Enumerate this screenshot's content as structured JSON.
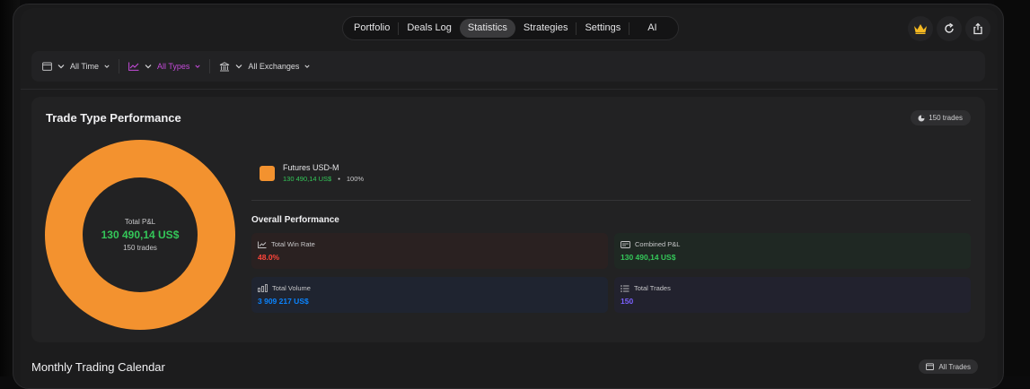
{
  "nav": {
    "tabs": [
      {
        "label": "Portfolio"
      },
      {
        "label": "Deals Log"
      },
      {
        "label": "Statistics"
      },
      {
        "label": "Strategies"
      },
      {
        "label": "Settings"
      },
      {
        "label": "AI"
      }
    ],
    "active": "Statistics",
    "icons": [
      "crown-icon",
      "refresh-icon",
      "share-icon"
    ]
  },
  "filters": {
    "time": "All Time",
    "types": "All Types",
    "exchanges": "All Exchanges"
  },
  "colors": {
    "accent_orange": "#f3922f",
    "positive_green": "#34c759",
    "negative_red": "#ff453a",
    "info_blue": "#0a84ff",
    "purple": "#7b61ff",
    "types_magenta": "#c44bd9"
  },
  "trade_type": {
    "title": "Trade Type Performance",
    "trades_badge": "150 trades",
    "total_label": "Total P&L",
    "total_value": "130 490,14 US$",
    "total_trades": "150 trades",
    "legend": [
      {
        "name": "Futures USD-M",
        "value": "130 490,14 US$",
        "percent": "100%"
      }
    ],
    "overall_title": "Overall Performance",
    "stats": {
      "win_rate": {
        "label": "Total Win Rate",
        "value": "48.0%"
      },
      "combined_pnl": {
        "label": "Combined P&L",
        "value": "130 490,14 US$"
      },
      "volume": {
        "label": "Total Volume",
        "value": "3 909 217 US$"
      },
      "trades": {
        "label": "Total Trades",
        "value": "150"
      }
    }
  },
  "chart_data": {
    "type": "pie",
    "categories": [
      "Futures USD-M"
    ],
    "values": [
      100
    ],
    "title": "Trade Type Performance"
  },
  "calendar": {
    "title": "Monthly Trading Calendar",
    "filter": "All Trades"
  }
}
